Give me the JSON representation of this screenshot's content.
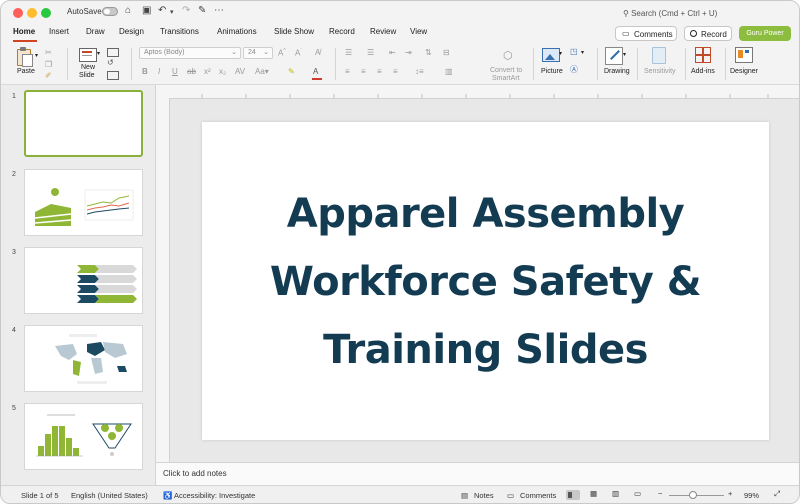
{
  "titlebar": {
    "autosave_label": "AutoSave",
    "search_placeholder": "Search (Cmd + Ctrl + U)"
  },
  "tabs": [
    "Home",
    "Insert",
    "Draw",
    "Design",
    "Transitions",
    "Animations",
    "Slide Show",
    "Record",
    "Review",
    "View"
  ],
  "actions": {
    "comments_label": "Comments",
    "record_label": "Record",
    "guru_label": "Guru Power"
  },
  "ribbon": {
    "paste": "Paste",
    "new_slide": [
      "New",
      "Slide"
    ],
    "font_name": "Aptos (Body)",
    "font_size": "24",
    "convert_smartart": [
      "Convert to",
      "SmartArt"
    ],
    "picture": "Picture",
    "drawing": "Drawing",
    "sensitivity": "Sensitivity",
    "addins": "Add-ins",
    "designer": "Designer"
  },
  "thumbnails": [
    {
      "number": "1",
      "selected": true
    },
    {
      "number": "2",
      "selected": false
    },
    {
      "number": "3",
      "selected": false
    },
    {
      "number": "4",
      "selected": false
    },
    {
      "number": "5",
      "selected": false
    }
  ],
  "slide": {
    "title_lines": [
      "Apparel Assembly",
      "Workforce Safety &",
      "Training Slides"
    ],
    "title_color": "#133b52"
  },
  "notes_placeholder": "Click to add notes",
  "status": {
    "slide_counter": "Slide 1 of 5",
    "language": "English (United States)",
    "accessibility": "Accessibility: Investigate",
    "notes": "Notes",
    "comments": "Comments",
    "zoom": "99%"
  },
  "colors": {
    "accent_tab": "#d04423",
    "guru_green": "#8cbd3f",
    "selected_thumb_border": "#8cb03c",
    "thumb_green": "#8fb735",
    "thumb_navy": "#1d4a63"
  }
}
